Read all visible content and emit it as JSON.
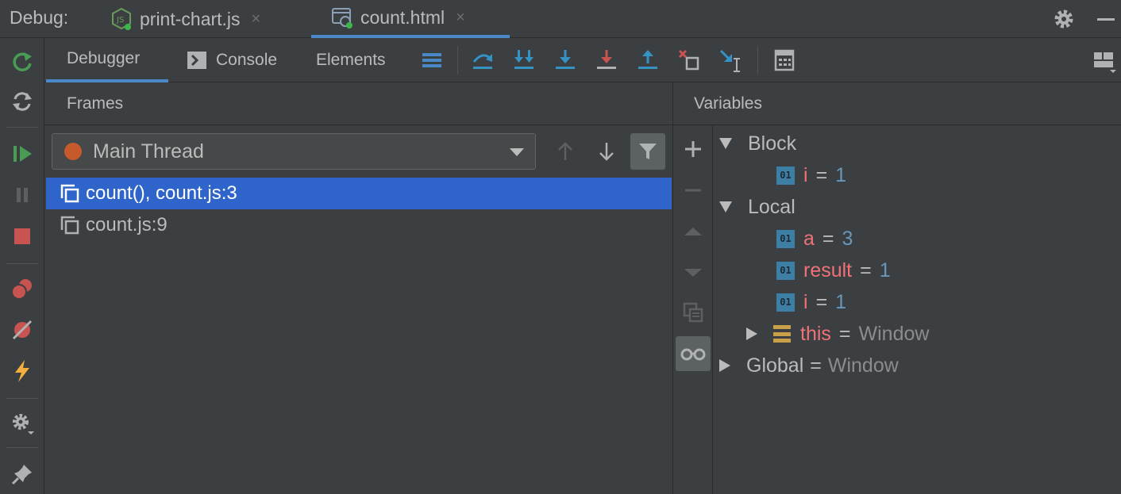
{
  "topbar": {
    "debug_label": "Debug:",
    "tabs": [
      {
        "label": "print-chart.js",
        "close": "×"
      },
      {
        "label": "count.html",
        "close": "×"
      }
    ]
  },
  "subtabs": [
    {
      "label": "Debugger"
    },
    {
      "label": "Console"
    },
    {
      "label": "Elements"
    }
  ],
  "frames": {
    "title": "Frames",
    "thread": "Main Thread",
    "rows": [
      {
        "label": "count(), count.js:3"
      },
      {
        "label": "count.js:9"
      }
    ]
  },
  "variables": {
    "title": "Variables",
    "scopes": {
      "block": {
        "name": "Block"
      },
      "local": {
        "name": "Local"
      },
      "global": {
        "name": "Global",
        "eq": "=",
        "value": "Window"
      }
    },
    "block_vars": [
      {
        "name": "i",
        "eq": "=",
        "value": "1"
      }
    ],
    "local_vars": [
      {
        "name": "a",
        "eq": "=",
        "value": "3"
      },
      {
        "name": "result",
        "eq": "=",
        "value": "1"
      },
      {
        "name": "i",
        "eq": "=",
        "value": "1"
      }
    ],
    "this_var": {
      "name": "this",
      "eq": "=",
      "value": "Window"
    }
  },
  "colors": {
    "accent": "#4a88c7",
    "selection": "#2f65ca",
    "var_name": "#f07178",
    "number": "#6897bb",
    "green": "#499c54",
    "red": "#c75450"
  }
}
